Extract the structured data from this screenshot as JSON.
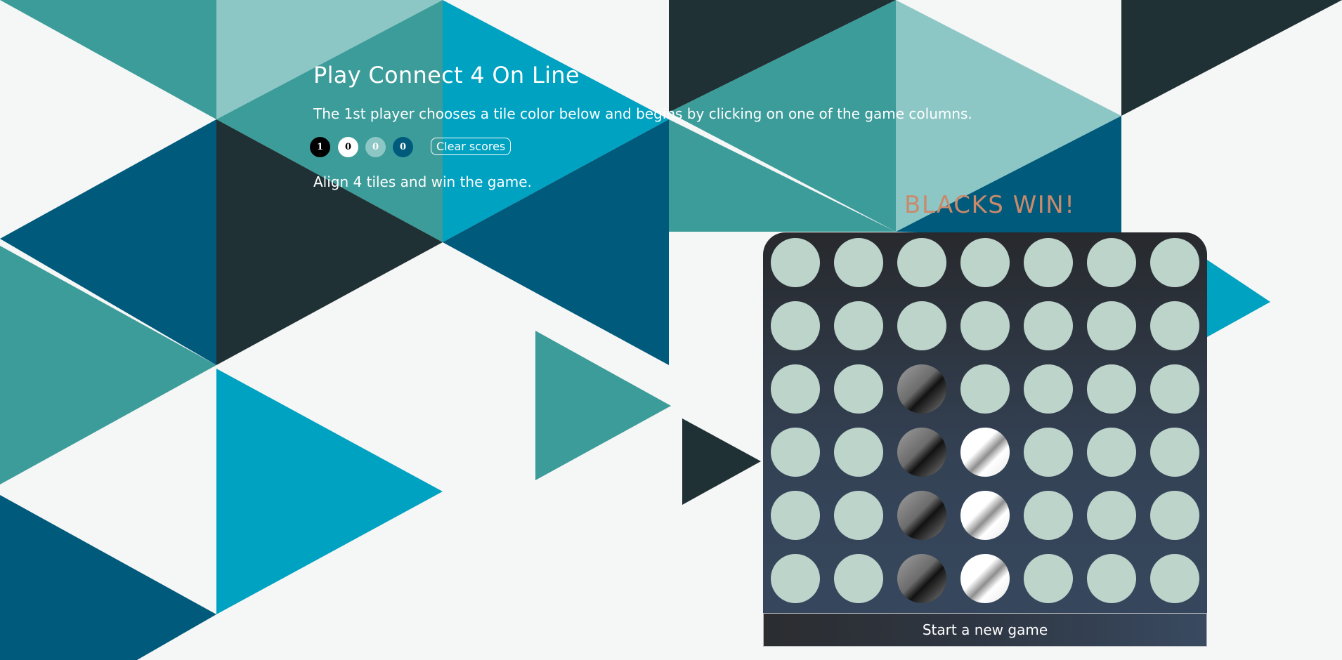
{
  "header": {
    "title": "Play Connect 4 On Line",
    "intro": "The 1st player chooses a tile color below and begins by clicking on one of the game columns.",
    "goal": "Align 4 tiles and win the game."
  },
  "scores": [
    {
      "name": "black",
      "value": "1",
      "color": "#000000"
    },
    {
      "name": "white",
      "value": "0",
      "color": "#ffffff"
    },
    {
      "name": "light-teal",
      "value": "0",
      "color": "#8dc7c5"
    },
    {
      "name": "navy",
      "value": "0",
      "color": "#005a7b"
    }
  ],
  "controls": {
    "clear_scores": "Clear scores",
    "new_game": "Start a new game"
  },
  "status": {
    "message": "BLACKS WIN!",
    "color": "#c98a6c"
  },
  "board": {
    "columns": 7,
    "rows": 6,
    "empty_color": "#bdd4cb",
    "cells": [
      [
        "empty",
        "empty",
        "empty",
        "empty",
        "empty",
        "empty",
        "empty"
      ],
      [
        "empty",
        "empty",
        "empty",
        "empty",
        "empty",
        "empty",
        "empty"
      ],
      [
        "empty",
        "empty",
        "black",
        "empty",
        "empty",
        "empty",
        "empty"
      ],
      [
        "empty",
        "empty",
        "black",
        "white",
        "empty",
        "empty",
        "empty"
      ],
      [
        "empty",
        "empty",
        "black",
        "white",
        "empty",
        "empty",
        "empty"
      ],
      [
        "empty",
        "empty",
        "black",
        "white",
        "empty",
        "empty",
        "empty"
      ]
    ]
  },
  "palette": {
    "dark": "#1f3135",
    "teal": "#3c9c9a",
    "light_teal": "#8dc7c5",
    "cyan": "#00a2c1",
    "navy": "#005a7b",
    "white": "#f5f6f6"
  }
}
